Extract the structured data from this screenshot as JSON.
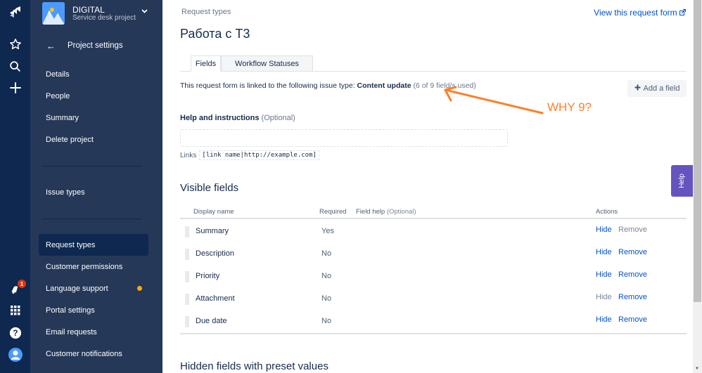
{
  "global_nav": {
    "logo_icon": "jira-service-desk-logo",
    "items": [
      "star-icon",
      "search-icon",
      "plus-icon"
    ],
    "bottom_items": [
      "notifications-icon",
      "app-switcher-icon",
      "help-icon",
      "profile-icon"
    ],
    "notification_count": "1"
  },
  "project": {
    "name": "DIGITAL",
    "type": "Service desk project"
  },
  "sidebar": {
    "back_label": "Project settings",
    "items": [
      {
        "label": "Details"
      },
      {
        "label": "People"
      },
      {
        "label": "Summary"
      },
      {
        "label": "Delete project"
      },
      {
        "label": "Issue types"
      },
      {
        "label": "Request types",
        "active": true
      },
      {
        "label": "Customer permissions"
      },
      {
        "label": "Language support",
        "has_dot": true
      },
      {
        "label": "Portal settings"
      },
      {
        "label": "Email requests"
      },
      {
        "label": "Customer notifications"
      }
    ]
  },
  "header": {
    "breadcrumb": "Request types",
    "title": "Работа с Т3",
    "view_link": "View this request form"
  },
  "tabs": [
    {
      "label": "Fields",
      "active": true
    },
    {
      "label": "Workflow Statuses",
      "active": false
    }
  ],
  "linked": {
    "prefix": "This request form is linked to the following issue type: ",
    "issue_type": "Content update",
    "usage": " (6 of 9 field/s used)"
  },
  "add_field_label": "Add a field",
  "help": {
    "label": "Help and instructions",
    "optional": " (Optional)",
    "value": "",
    "links_label": "Links",
    "links_example": "[link name|http://example.com]"
  },
  "visible_fields": {
    "heading": "Visible fields",
    "columns": {
      "display_name": "Display name",
      "required": "Required",
      "field_help": "Field help",
      "field_help_optional": " (Optional)",
      "actions": "Actions"
    },
    "rows": [
      {
        "name": "Summary",
        "required": "Yes",
        "hide": "Hide",
        "remove": "Remove",
        "hide_enabled": true,
        "remove_enabled": false
      },
      {
        "name": "Description",
        "required": "No",
        "hide": "Hide",
        "remove": "Remove",
        "hide_enabled": true,
        "remove_enabled": true
      },
      {
        "name": "Priority",
        "required": "No",
        "hide": "Hide",
        "remove": "Remove",
        "hide_enabled": true,
        "remove_enabled": true
      },
      {
        "name": "Attachment",
        "required": "No",
        "hide": "Hide",
        "remove": "Remove",
        "hide_enabled": false,
        "remove_enabled": true
      },
      {
        "name": "Due date",
        "required": "No",
        "hide": "Hide",
        "remove": "Remove",
        "hide_enabled": true,
        "remove_enabled": true
      }
    ]
  },
  "hidden_fields_heading": "Hidden fields with preset values",
  "help_tab_label": "Help",
  "annotation": {
    "text": "WHY 9?",
    "color": "#ff7f27"
  },
  "colors": {
    "global_nav": "#0e2850",
    "sidebar": "#253858",
    "link": "#0052cc",
    "help_tab": "#6554c0"
  }
}
